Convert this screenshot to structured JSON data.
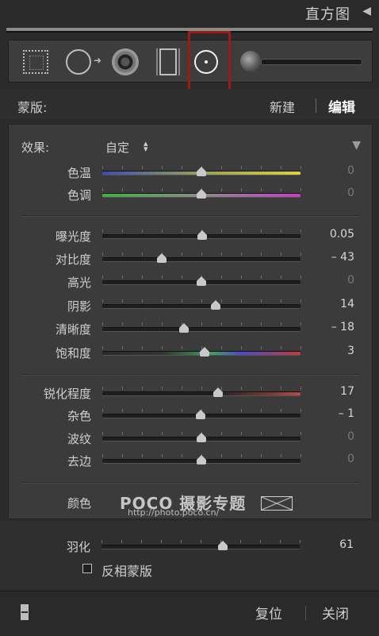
{
  "header": {
    "title": "直方图",
    "collapse_icon": "triangle-left-icon"
  },
  "toolbar": {
    "tools": [
      {
        "name": "crop-tool-icon"
      },
      {
        "name": "spot-removal-icon"
      },
      {
        "name": "red-eye-icon"
      },
      {
        "name": "graduated-filter-icon"
      },
      {
        "name": "radial-filter-icon",
        "selected": true
      },
      {
        "name": "adjustment-brush-icon"
      }
    ],
    "highlight_color": "#a01818"
  },
  "mask": {
    "label": "蒙版:",
    "new_label": "新建",
    "edit_label": "编辑"
  },
  "effect": {
    "label": "效果:",
    "value": "自定",
    "value_arrows": "⌃⌄"
  },
  "sliders": [
    {
      "id": "temp",
      "label": "色温",
      "value": "0",
      "position": 0.5,
      "dim": true,
      "gradient": "linear-gradient(90deg,#3c4fb0,#9aa05a,#d8d23a)"
    },
    {
      "id": "tint",
      "label": "色调",
      "value": "0",
      "position": 0.5,
      "dim": true,
      "gradient": "linear-gradient(90deg,#3fb03f,#8a8a8a,#c43fc4)"
    },
    {
      "id": "exposure",
      "label": "曝光度",
      "value": "0.05",
      "position": 0.505,
      "dim": false
    },
    {
      "id": "contrast",
      "label": "对比度",
      "value": "– 43",
      "position": 0.3,
      "dim": false
    },
    {
      "id": "highlights",
      "label": "高光",
      "value": "0",
      "position": 0.5,
      "dim": true
    },
    {
      "id": "shadows",
      "label": "阴影",
      "value": "14",
      "position": 0.57,
      "dim": false
    },
    {
      "id": "clarity",
      "label": "清晰度",
      "value": "– 18",
      "position": 0.41,
      "dim": false
    },
    {
      "id": "saturation",
      "label": "饱和度",
      "value": "3",
      "position": 0.515,
      "dim": false,
      "gradient": "linear-gradient(90deg,#2a2a2a,#333 30%,#3aa35a 55%,#4a4ad0 70%,#c43a3a)"
    },
    {
      "id": "sharpness",
      "label": "锐化程度",
      "value": "17",
      "position": 0.585,
      "dim": false,
      "gradient": "linear-gradient(90deg,#1e1e1e 55%,#7a3a3a 85%,#b84a4a)"
    },
    {
      "id": "noise",
      "label": "杂色",
      "value": "– 1",
      "position": 0.495,
      "dim": false
    },
    {
      "id": "moire",
      "label": "波纹",
      "value": "0",
      "position": 0.5,
      "dim": true
    },
    {
      "id": "defringe",
      "label": "去边",
      "value": "0",
      "position": 0.5,
      "dim": true
    }
  ],
  "color": {
    "label": "颜色",
    "swatch_icon": "empty-color-swatch-icon"
  },
  "watermark": {
    "brand": "POCO 摄影专题",
    "url": "http://photo.poco.cn/"
  },
  "feather": {
    "label": "羽化",
    "value": "61",
    "position": 0.61,
    "invert_label": "反相蒙版",
    "invert_checked": false
  },
  "bottom": {
    "reset_label": "复位",
    "close_label": "关闭",
    "toggle_icon": "toggle-switch-icon"
  }
}
